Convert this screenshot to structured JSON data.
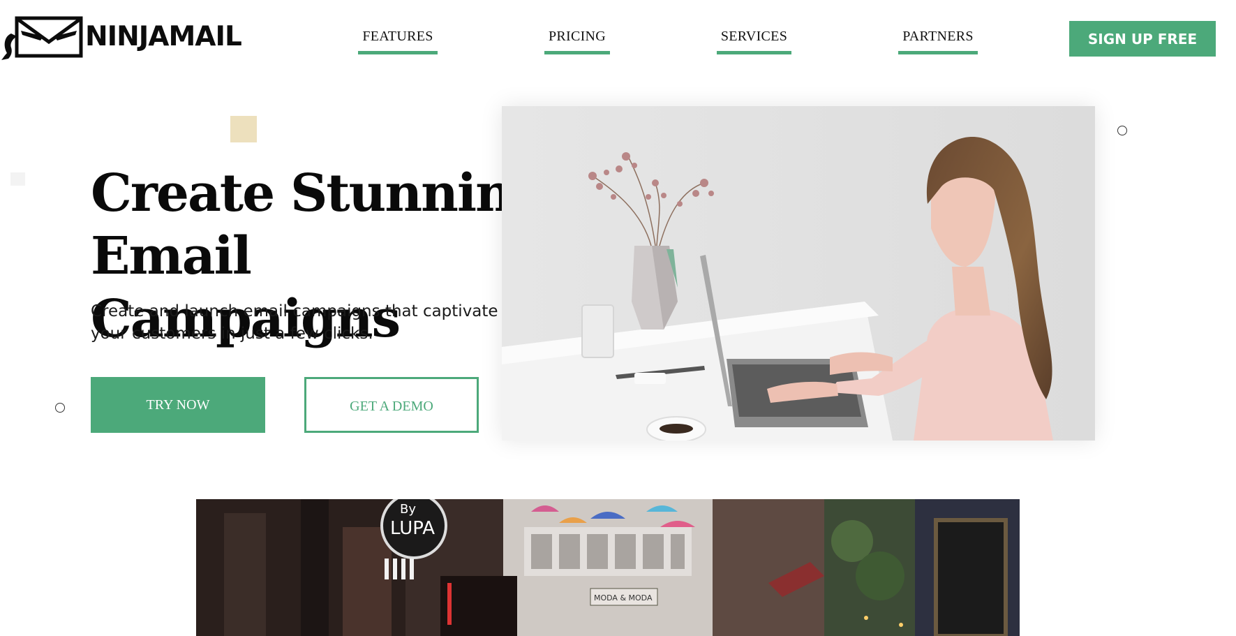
{
  "brand": {
    "name": "NINJAMAIL",
    "logo_icon": "ninja-envelope-icon"
  },
  "nav": {
    "items": [
      {
        "label": "FEATURES"
      },
      {
        "label": "PRICING"
      },
      {
        "label": "SERVICES"
      },
      {
        "label": "PARTNERS"
      }
    ],
    "signup_label": "SIGN UP FREE"
  },
  "hero": {
    "title_line1": "Create Stunning",
    "title_line2": "Email Campaigns",
    "subtitle": "Create and launch email campaigns that captivate your customers in just a few clicks.",
    "primary_cta": "TRY NOW",
    "secondary_cta": "GET A DEMO"
  },
  "street_photo": {
    "sign_by": "By",
    "sign_lupa": "LUPA",
    "sign_moda": "MODA & MODA"
  },
  "colors": {
    "accent": "#4ca97a",
    "text": "#111111",
    "decor_square": "#ede0bd"
  }
}
